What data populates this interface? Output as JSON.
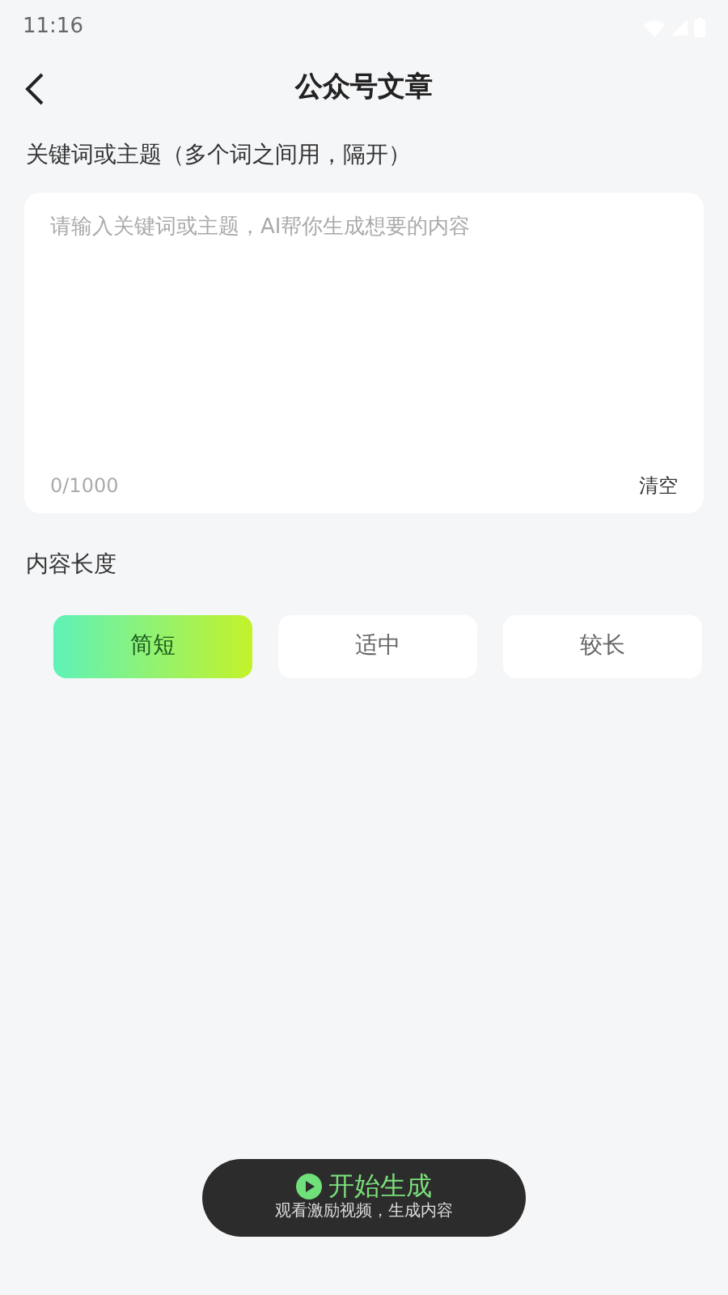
{
  "status_bar": {
    "time": "11:16"
  },
  "header": {
    "title": "公众号文章"
  },
  "keywords": {
    "label": "关键词或主题（多个词之间用，隔开）",
    "placeholder": "请输入关键词或主题，AI帮你生成想要的内容",
    "counter": "0/1000",
    "clear": "清空"
  },
  "length": {
    "label": "内容长度",
    "options": [
      {
        "label": "简短",
        "selected": true
      },
      {
        "label": "适中",
        "selected": false
      },
      {
        "label": "较长",
        "selected": false
      }
    ]
  },
  "generate": {
    "label": "开始生成",
    "note": "观看激励视频，生成内容"
  }
}
